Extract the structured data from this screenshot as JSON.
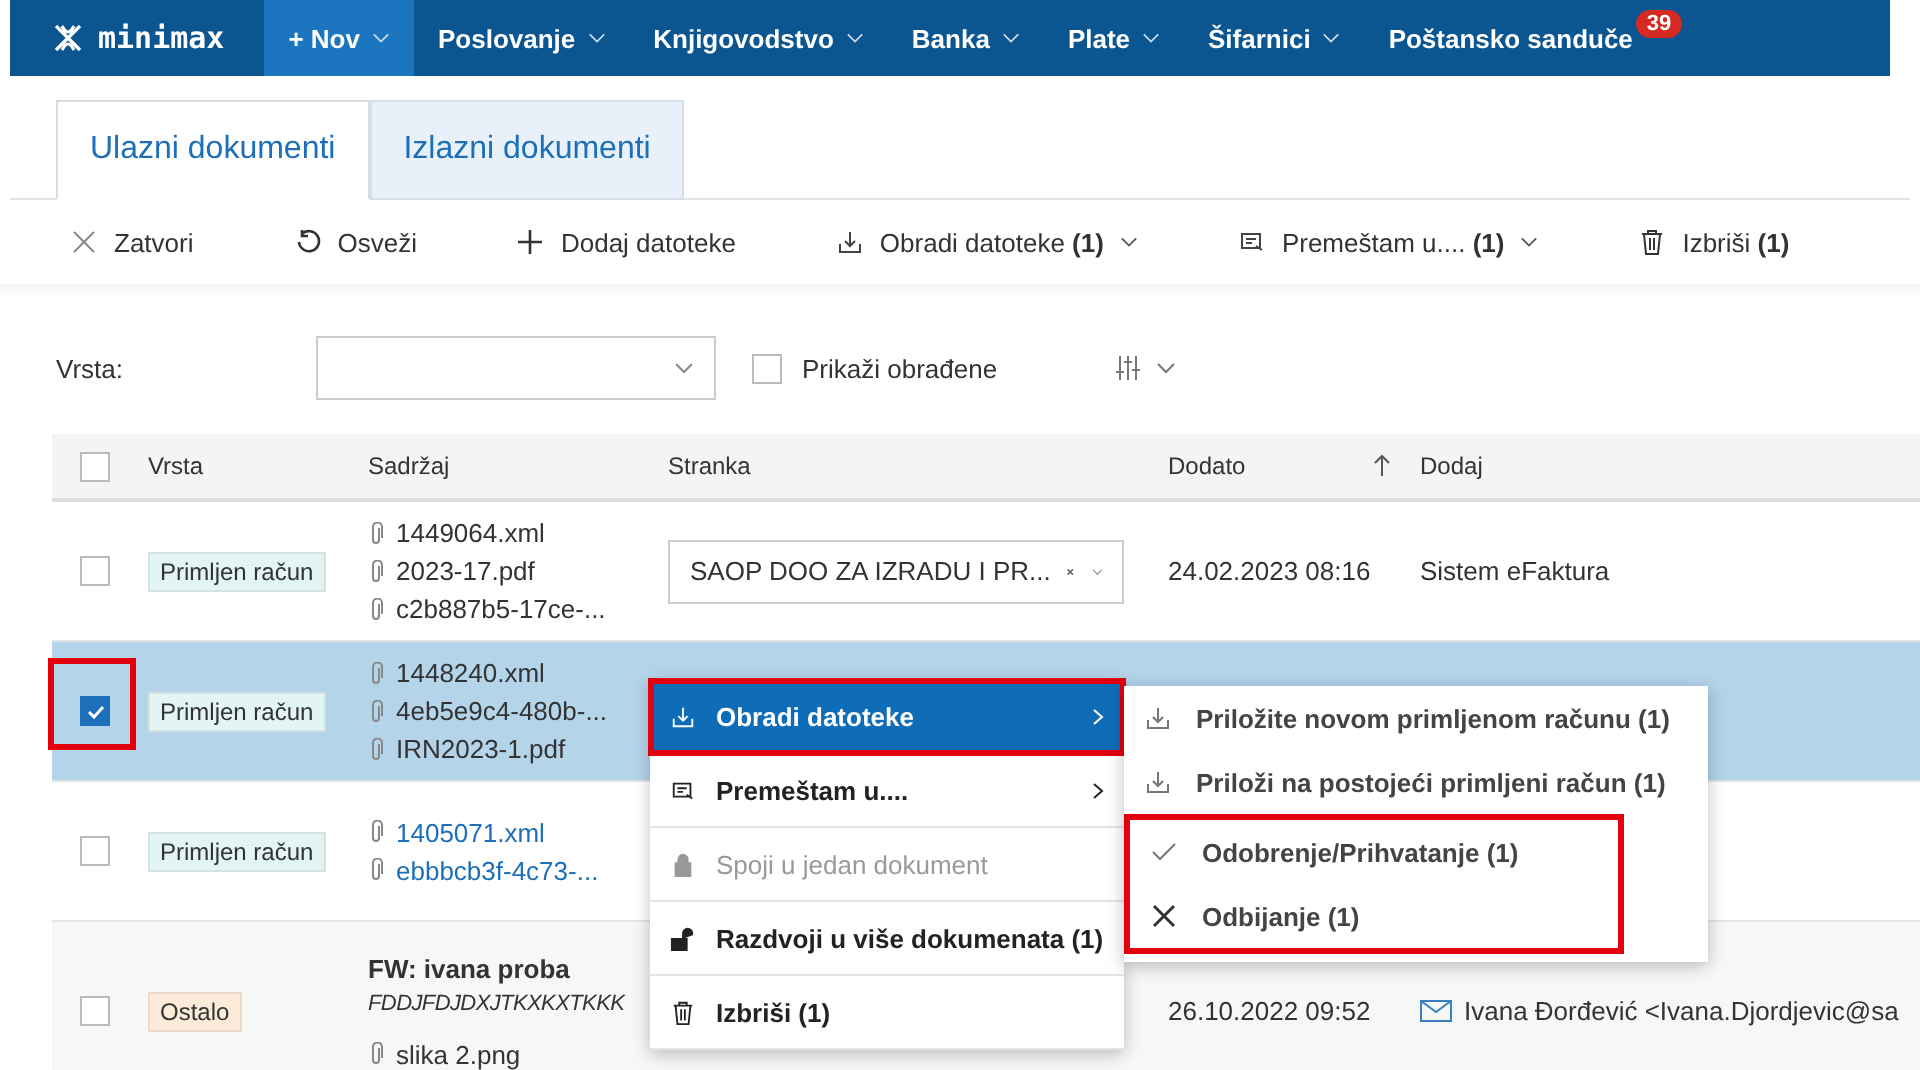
{
  "nav": {
    "logo": "minimax",
    "items": [
      {
        "label": "+ Nov",
        "selected": true,
        "has_menu": true
      },
      {
        "label": "Poslovanje",
        "selected": false,
        "has_menu": true
      },
      {
        "label": "Knjigovodstvo",
        "selected": false,
        "has_menu": true
      },
      {
        "label": "Banka",
        "selected": false,
        "has_menu": true
      },
      {
        "label": "Plate",
        "selected": false,
        "has_menu": true
      },
      {
        "label": "Šifarnici",
        "selected": false,
        "has_menu": true
      },
      {
        "label": "Poštansko sanduče",
        "selected": false,
        "has_menu": false,
        "badge": "39"
      }
    ]
  },
  "tabs": [
    {
      "label": "Ulazni dokumenti",
      "selected": true
    },
    {
      "label": "Izlazni dokumenti",
      "selected": false
    }
  ],
  "toolbar": [
    {
      "label": "Zatvori",
      "has_menu": false
    },
    {
      "label": "Osveži",
      "has_menu": false
    },
    {
      "label": "Dodaj datoteke",
      "has_menu": false
    },
    {
      "label": "Obradi datoteke **(1)**",
      "has_menu": true
    },
    {
      "label": "Premeštam u.... **(1)**",
      "has_menu": true
    },
    {
      "label": "Izbriši **(1)**",
      "has_menu": false
    }
  ],
  "filter": {
    "label": "Vrsta:",
    "show_processed": {
      "label": "Prikaži obrađene",
      "checked": false
    }
  },
  "table": {
    "select_all": {
      "checked": false
    },
    "columns": [
      {
        "label": "Vrsta",
        "sorted": false
      },
      {
        "label": "Sadržaj",
        "sorted": false
      },
      {
        "label": "Stranka",
        "sorted": false
      },
      {
        "label": "Dodato",
        "sorted": true
      },
      {
        "label": "Dodaj",
        "sorted": false
      }
    ],
    "rows": [
      {
        "checked": false,
        "highlighted": false,
        "type": "Primljen račun",
        "type_tag": {
          "color": "#e3f4f4"
        },
        "files": [
          "1449064.xml",
          "2023-17.pdf",
          "c2b887b5-17ce-..."
        ],
        "files_linked": false,
        "party": "SAOP DOO ZA IZRADU I PR...",
        "date": "24.02.2023 08:16",
        "added_by": "Sistem eFaktura"
      },
      {
        "checked": true,
        "highlighted": true,
        "type": "Primljen račun",
        "type_tag": {
          "color": "#e3f4f4"
        },
        "files": [
          "1448240.xml",
          "4eb5e9c4-480b-...",
          "IRN2023-1.pdf"
        ],
        "files_linked": false
      },
      {
        "checked": false,
        "highlighted": false,
        "type": "Primljen račun",
        "type_tag": {
          "color": "#e3f4f4"
        },
        "files": [
          "1405071.xml",
          "ebbbcb3f-4c73-..."
        ],
        "files_linked": true
      },
      {
        "checked": false,
        "highlighted": false,
        "type": "Ostalo",
        "type_tag": {
          "color": "#fcebd9"
        },
        "title": "FW: ivana proba",
        "note": "FDDJFDJDXJTKXKXTKKK",
        "files": [
          "slika 2.png"
        ],
        "files_linked": false,
        "date": "26.10.2022 09:52",
        "added_by": "Ivana Đorđević <Ivana.Djordjevic@sa",
        "added_by_email": true
      }
    ]
  },
  "context_menu": {
    "items": [
      {
        "label": "Obradi datoteke",
        "selected": true,
        "highlighted": true,
        "disabled": false,
        "has_submenu": true
      },
      {
        "label": "Premeštam u....",
        "selected": false,
        "highlighted": false,
        "disabled": false,
        "has_submenu": true
      },
      {
        "label": "Spoji u jedan dokument",
        "selected": false,
        "highlighted": false,
        "disabled": true,
        "has_submenu": false
      },
      {
        "label": "Razdvoji u više dokumenata (1)",
        "selected": false,
        "highlighted": false,
        "disabled": false,
        "has_submenu": false
      },
      {
        "label": "Izbriši (1)",
        "selected": false,
        "highlighted": false,
        "disabled": false,
        "has_submenu": false
      }
    ]
  },
  "submenu": {
    "sections": [
      {
        "highlighted": false,
        "items": [
          "Priložite novom primljenom računu (1)",
          "Priloži na postojeći primljeni račun (1)"
        ]
      },
      {
        "highlighted": true,
        "items": [
          "Odobrenje/Prihvatanje (1)",
          "Odbijanje (1)"
        ]
      }
    ]
  }
}
